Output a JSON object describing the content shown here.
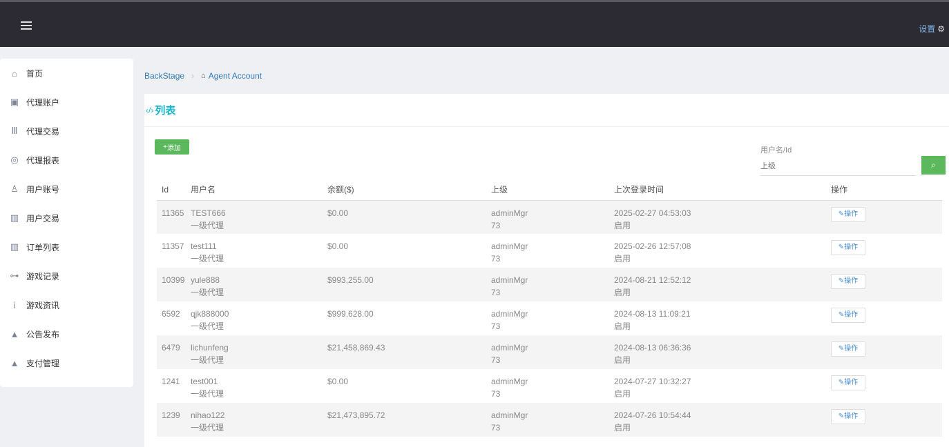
{
  "topbar": {
    "menu_icon": "hamburger-icon",
    "settings_label": "设置",
    "settings_icon": "gear-icon"
  },
  "sidebar": {
    "items": [
      {
        "label": "首页",
        "icon": "home-icon"
      },
      {
        "label": "代理账户",
        "icon": "lock-icon"
      },
      {
        "label": "代理交易",
        "icon": "bank-icon"
      },
      {
        "label": "代理报表",
        "icon": "lifebuoy-icon"
      },
      {
        "label": "用户账号",
        "icon": "user-icon"
      },
      {
        "label": "用户交易",
        "icon": "briefcase-icon"
      },
      {
        "label": "订单列表",
        "icon": "briefcase-icon"
      },
      {
        "label": "游戏记录",
        "icon": "gamepad-icon"
      },
      {
        "label": "游戏资讯",
        "icon": "info-icon"
      },
      {
        "label": "公告发布",
        "icon": "bell-icon"
      },
      {
        "label": "支付管理",
        "icon": "bell-icon"
      }
    ]
  },
  "breadcrumb": {
    "root": "BackStage",
    "current": "Agent Account"
  },
  "panel": {
    "code_icon": "code-icon",
    "title": "列表"
  },
  "toolbar": {
    "add_label": "添加"
  },
  "search": {
    "label": "用户名/Id",
    "placeholder": "上级"
  },
  "table": {
    "headers": [
      "Id",
      "用户名",
      "余额($)",
      "上级",
      "上次登录时间",
      "操作"
    ],
    "action_label": "操作",
    "rows": [
      {
        "id": "11365",
        "username": "TEST666",
        "level": "一级代理",
        "balance": "$0.00",
        "parent": "adminMgr",
        "parent_id": "73",
        "last_login": "2025-02-27 04:53:03",
        "status": "启用"
      },
      {
        "id": "11357",
        "username": "test111",
        "level": "一级代理",
        "balance": "$0.00",
        "parent": "adminMgr",
        "parent_id": "73",
        "last_login": "2025-02-26 12:57:08",
        "status": "启用"
      },
      {
        "id": "10399",
        "username": "yule888",
        "level": "一级代理",
        "balance": "$993,255.00",
        "parent": "adminMgr",
        "parent_id": "73",
        "last_login": "2024-08-21 12:52:12",
        "status": "启用"
      },
      {
        "id": "6592",
        "username": "qjk888000",
        "level": "一级代理",
        "balance": "$999,628.00",
        "parent": "adminMgr",
        "parent_id": "73",
        "last_login": "2024-08-13 11:09:21",
        "status": "启用"
      },
      {
        "id": "6479",
        "username": "lichunfeng",
        "level": "一级代理",
        "balance": "$21,458,869.43",
        "parent": "adminMgr",
        "parent_id": "73",
        "last_login": "2024-08-13 06:36:36",
        "status": "启用"
      },
      {
        "id": "1241",
        "username": "test001",
        "level": "一级代理",
        "balance": "$0.00",
        "parent": "adminMgr",
        "parent_id": "73",
        "last_login": "2024-07-27 10:32:27",
        "status": "启用"
      },
      {
        "id": "1239",
        "username": "nihao122",
        "level": "一级代理",
        "balance": "$21,473,895.72",
        "parent": "adminMgr",
        "parent_id": "73",
        "last_login": "2024-07-26 10:54:44",
        "status": "启用"
      }
    ]
  }
}
